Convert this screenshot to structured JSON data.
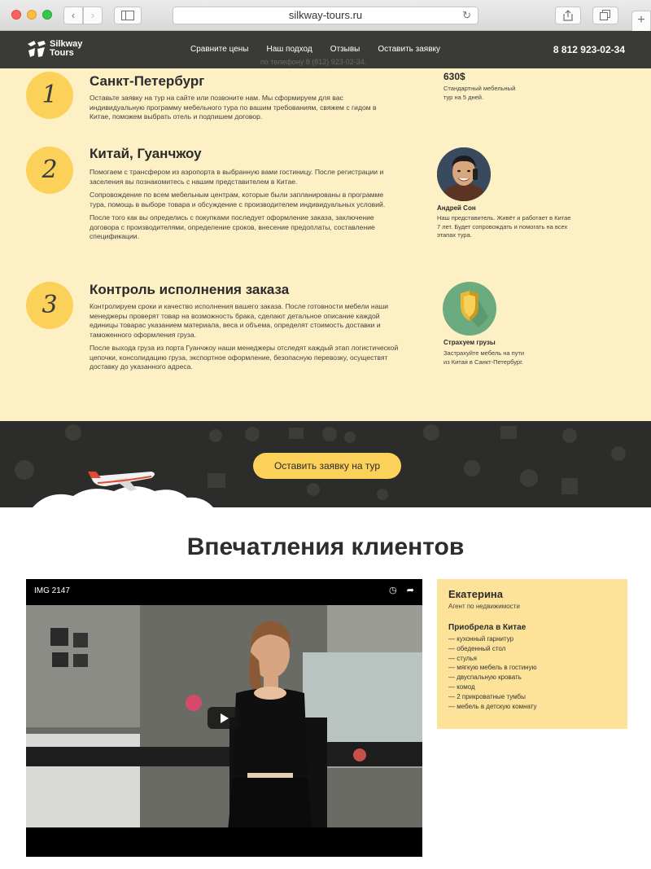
{
  "browser": {
    "url": "silkway-tours.ru",
    "back_icon": "‹",
    "forward_icon": "›",
    "reload_icon": "↻",
    "plus_icon": "+"
  },
  "header": {
    "logo_line1": "Silkway",
    "logo_line2": "Tours",
    "nav": [
      "Сравните цены",
      "Наш подход",
      "Отзывы",
      "Оставить заявку"
    ],
    "phone": "8 812 923-02-34",
    "faint_text": "по телефону 8 (812) 923-02-34."
  },
  "steps": [
    {
      "number": "1",
      "title": "Санкт-Петербург",
      "paragraphs": [
        "Оставьте заявку на тур на сайте или позвоните нам. Мы сформируем для вас индивидуальную программу мебельного тура по вашим требованиям, свяжем с гидом в Китае, поможем выбрать отель и подпишем договор."
      ],
      "side_title": "630$",
      "side_text": "Стандартный мебельный тур на 5 дней."
    },
    {
      "number": "2",
      "title": "Китай, Гуанчжоу",
      "paragraphs": [
        "Помогаем с трансфером из аэропорта в выбранную вами гостиницу. После регистрации и заселения вы познакомитесь с нашим представителем в Китае.",
        "Сопровождение по всем мебельным центрам, которые были запланированы в программе тура, помощь в выборе товара и обсуждение с производителем индивидуальных условий.",
        "После того как вы определись с покупками последует оформление заказа, заключение договора с производителями, определение сроков, внесение предоплаты, составление спецификации."
      ],
      "side_title": "Андрей Сон",
      "side_text": "Наш представитель. Живёт и работает в Китае 7 лет. Будет сопровождать и помогать на всех этапах тура."
    },
    {
      "number": "3",
      "title": "Контроль исполнения заказа",
      "paragraphs": [
        "Контролируем сроки и качество исполнения вашего заказа. После готовности мебели наши менеджеры проверят товар на возможность брака, сделают детальное описание каждой единицы товарас указанием материала, веса и объема, определят стоимость доставки и таможенного оформления груза.",
        "После выхода груза из порта Гуанчжоу наши менеджеры отследят каждый этап логистической цепочки, консолидацию груза, экспортное оформление, безопасную перевозку, осуществят доставку до указанного адреса."
      ],
      "side_title": "Страхуем грузы",
      "side_text": "Застрахуйте мебель на пути из Китая в Санкт-Петербург."
    }
  ],
  "cta": {
    "label": "Оставить заявку на тур"
  },
  "reviews": {
    "title": "Впечатления клиентов",
    "video_title": "IMG 2147",
    "clock_icon": "◷",
    "share_icon": "➦",
    "card": {
      "name": "Екатерина",
      "role": "Агент по недвижимости",
      "purchases_title": "Приобрела в Китае",
      "items": [
        "— кухонный гарнитур",
        "— обеденный стол",
        "— стулья",
        "— мягкую мебель в гостиную",
        "— двуспальную кровать",
        "— комод",
        "— 2 прикроватные тумбы",
        "— мебель в детскую комнату"
      ]
    }
  }
}
